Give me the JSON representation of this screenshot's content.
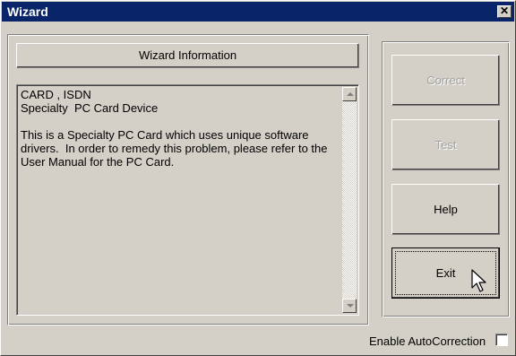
{
  "window": {
    "title": "Wizard"
  },
  "info": {
    "header": "Wizard Information",
    "text": "CARD , ISDN\nSpecialty  PC Card Device\n\nThis is a Specialty PC Card which uses unique software\ndrivers.  In order to remedy this problem, please refer to the\nUser Manual for the PC Card."
  },
  "buttons": {
    "correct": "Correct",
    "test": "Test",
    "help": "Help",
    "exit": "Exit"
  },
  "footer": {
    "autocorrect_label": "Enable AutoCorrection",
    "autocorrect_checked": false
  },
  "icons": {
    "close": "close-icon",
    "scroll_up": "scroll-up-arrow-icon",
    "scroll_down": "scroll-down-arrow-icon",
    "cursor": "mouse-pointer-icon"
  }
}
